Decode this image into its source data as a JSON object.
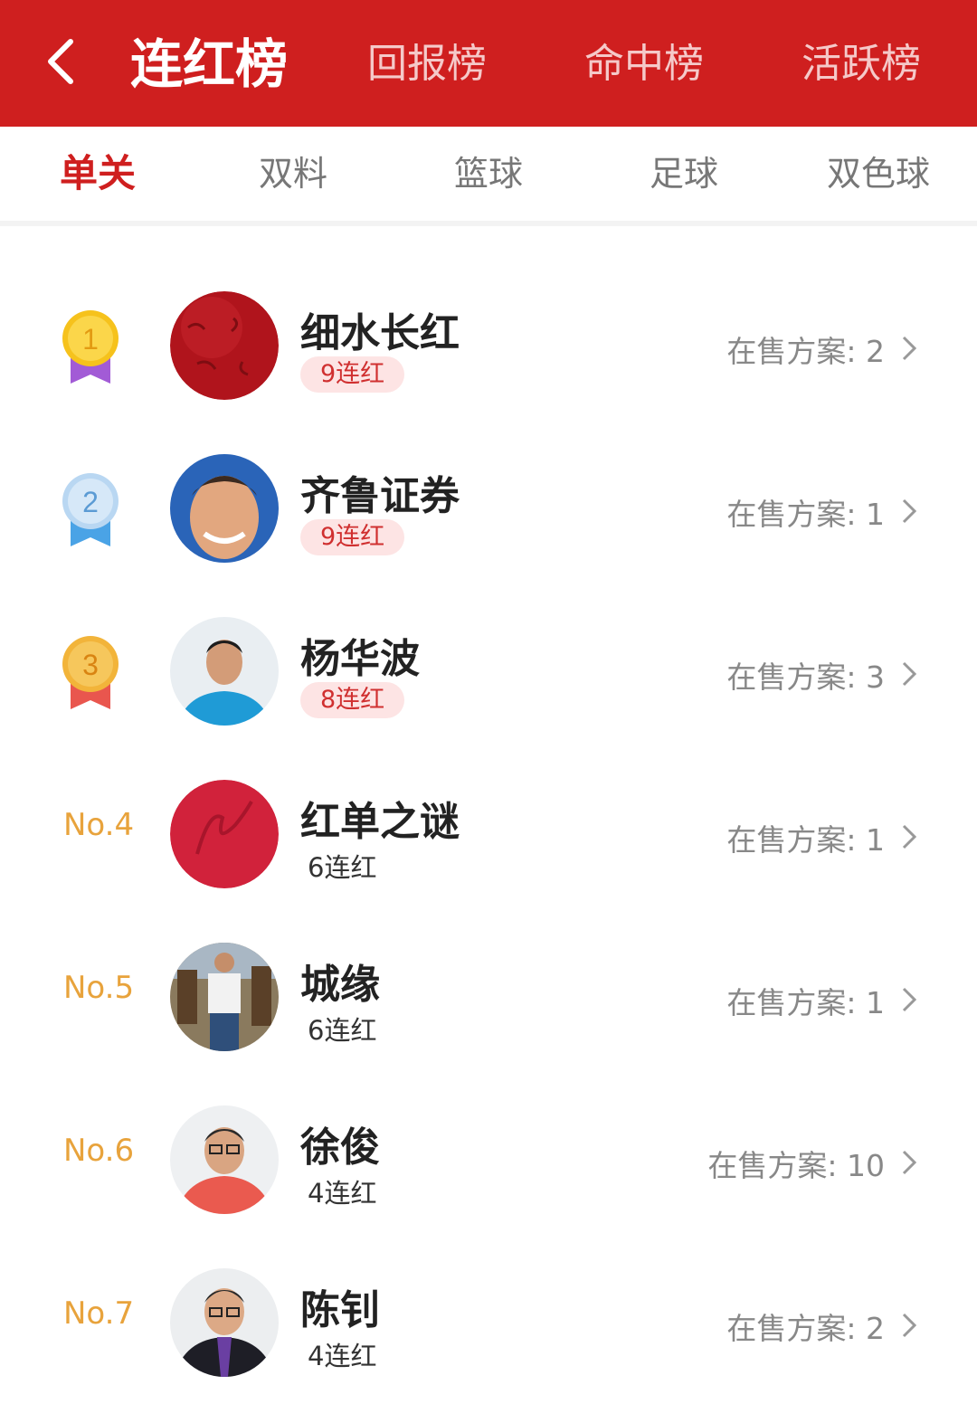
{
  "header": {
    "tabs": [
      {
        "label": "连红榜"
      },
      {
        "label": "回报榜"
      },
      {
        "label": "命中榜"
      },
      {
        "label": "活跃榜"
      }
    ]
  },
  "categories": [
    {
      "label": "单关"
    },
    {
      "label": "双料"
    },
    {
      "label": "篮球"
    },
    {
      "label": "足球"
    },
    {
      "label": "双色球"
    }
  ],
  "ranking": [
    {
      "rank": "1",
      "name": "细水长红",
      "streak": "9连红",
      "sale_label": "在售方案:",
      "sale_count": "2"
    },
    {
      "rank": "2",
      "name": "齐鲁证券",
      "streak": "9连红",
      "sale_label": "在售方案:",
      "sale_count": "1"
    },
    {
      "rank": "3",
      "name": "杨华波",
      "streak": "8连红",
      "sale_label": "在售方案:",
      "sale_count": "3"
    },
    {
      "rank": "No.4",
      "name": "红单之谜",
      "streak": "6连红",
      "sale_label": "在售方案:",
      "sale_count": "1"
    },
    {
      "rank": "No.5",
      "name": "城缘",
      "streak": "6连红",
      "sale_label": "在售方案:",
      "sale_count": "1"
    },
    {
      "rank": "No.6",
      "name": "徐俊",
      "streak": "4连红",
      "sale_label": "在售方案:",
      "sale_count": "10"
    },
    {
      "rank": "No.7",
      "name": "陈钊",
      "streak": "4连红",
      "sale_label": "在售方案:",
      "sale_count": "2"
    }
  ],
  "colors": {
    "brand_red": "#cf1f1f",
    "gold_medal": "#f6c21c",
    "silver_medal": "#b9d7f2",
    "bronze_medal": "#f2b43a",
    "rank_text": "#e8a33c",
    "streak_pill_bg": "#fde4e4"
  }
}
